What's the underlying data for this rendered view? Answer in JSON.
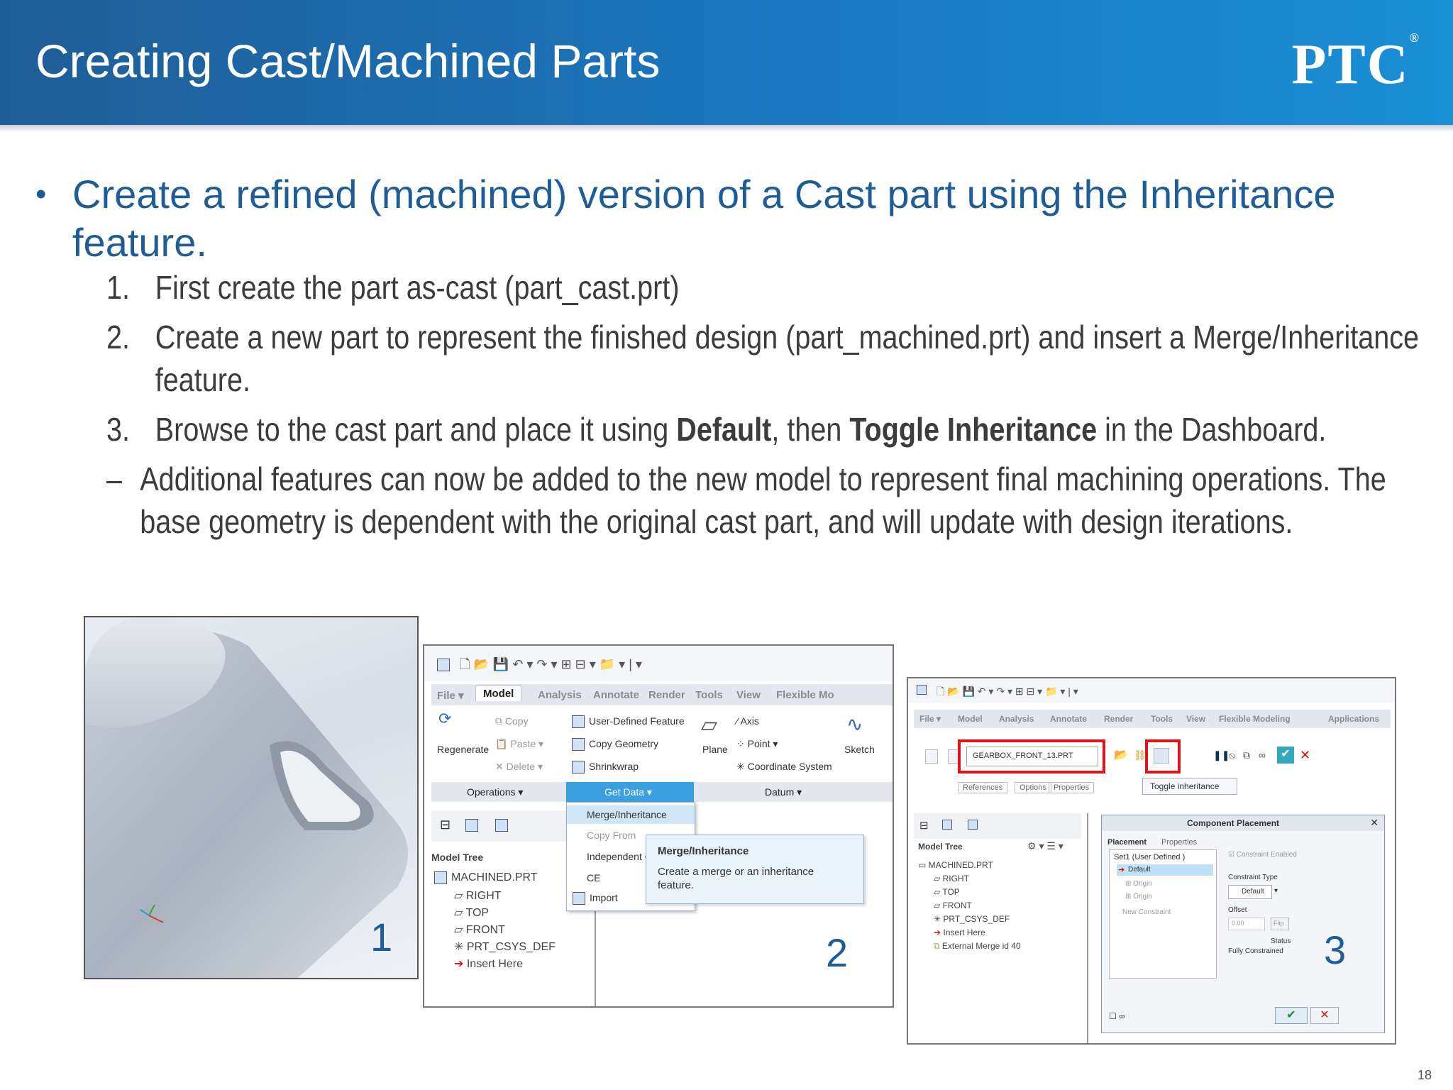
{
  "header": {
    "title": "Creating Cast/Machined Parts",
    "logo": "PTC",
    "logo_mark": "®"
  },
  "bullet": {
    "dot": "•",
    "text": "Create a refined (machined) version of a Cast part using the Inheritance feature."
  },
  "steps": [
    {
      "num": "1.",
      "text": "First create the part as-cast (part_cast.prt)"
    },
    {
      "num": "2.",
      "text": "Create a new part to represent the finished design (part_machined.prt) and insert a Merge/Inheritance feature."
    },
    {
      "num": "3.",
      "pre": "Browse to the cast part and place it using ",
      "b1": "Default",
      "mid": ", then ",
      "b2": "Toggle Inheritance",
      "post": " in the Dashboard."
    },
    {
      "num": "–",
      "text": "Additional features can now be added to the new model to represent final machining operations. The base geometry is dependent with the original cast part, and will update with design iterations."
    }
  ],
  "figures": {
    "n1": "1",
    "n2": "2",
    "n3": "3"
  },
  "page_number": "18",
  "panel2": {
    "tabs": [
      "File ▾",
      "Model",
      "Analysis",
      "Annotate",
      "Render",
      "Tools",
      "View",
      "Flexible Mo"
    ],
    "ops": {
      "regenerate": "Regenerate",
      "copy": "Copy",
      "paste": "Paste",
      "delete": "Delete"
    },
    "getdata": {
      "udf": "User-Defined Feature",
      "copygeom": "Copy Geometry",
      "shrink": "Shrinkwrap"
    },
    "datum": {
      "plane": "Plane",
      "axis": "Axis",
      "point": "Point",
      "csys": "Coordinate System",
      "sketch": "Sketch"
    },
    "groups": {
      "operations": "Operations ▾",
      "getdata": "Get Data ▾",
      "datum": "Datum ▾"
    },
    "menu": [
      "Merge/Inheritance",
      "Copy From",
      "Independent Geometry",
      "CE",
      "Import"
    ],
    "tooltip": {
      "title": "Merge/Inheritance",
      "body": "Create a merge or an inheritance feature."
    },
    "tree": {
      "header": "Model Tree",
      "items": [
        "MACHINED.PRT",
        "RIGHT",
        "TOP",
        "FRONT",
        "PRT_CSYS_DEF",
        "Insert Here"
      ]
    }
  },
  "panel3": {
    "tabs": [
      "File ▾",
      "Model",
      "Analysis",
      "Annotate",
      "Render",
      "Tools",
      "View",
      "Flexible Modeling",
      "Applications"
    ],
    "file_field": "GEARBOX_FRONT_13.PRT",
    "dash_tabs": [
      "References",
      "Options",
      "Properties"
    ],
    "toggle_tip": "Toggle inheritance",
    "tree": {
      "header": "Model Tree",
      "items": [
        "MACHINED.PRT",
        "RIGHT",
        "TOP",
        "FRONT",
        "PRT_CSYS_DEF",
        "Insert Here",
        "External Merge id 40"
      ]
    },
    "dialog": {
      "title": "Component Placement",
      "tabs": [
        "Placement",
        "Properties"
      ],
      "set": "Set1 (User Defined )",
      "constraint": "Default",
      "origin1": "Origin",
      "origin2": "Origin",
      "new_constraint": "New Constraint",
      "enabled": "Constraint Enabled",
      "type_label": "Constraint Type",
      "type_value": "Default",
      "offset_label": "Offset",
      "offset_value": "0.00",
      "flip": "Flip",
      "status_label": "Status",
      "status_value": "Fully Constrained"
    }
  },
  "colors": {
    "accent": "#1f5d97",
    "header_start": "#1f5d97",
    "header_end": "#1a8fd6",
    "highlight": "#e0131b",
    "ribbon_sel": "#3aa0e0"
  }
}
